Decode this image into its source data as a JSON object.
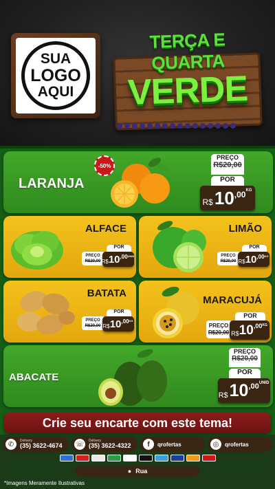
{
  "logo": {
    "line1": "SUA",
    "line2": "LOGO",
    "line3": "AQUI"
  },
  "hero": {
    "top": "TERÇA E QUARTA",
    "main": "VERDE"
  },
  "products": [
    {
      "name": "LARANJA",
      "badge": "-50%",
      "de_label": "PREÇO",
      "old_price": "R$20,00",
      "por_label": "POR",
      "currency": "R$",
      "price": "10",
      "cents": ",00",
      "unit": "KG"
    },
    {
      "name": "ALFACE",
      "de_label": "PREÇO",
      "old_price": "R$20,00",
      "por_label": "POR",
      "currency": "R$",
      "price": "10",
      "cents": ",00",
      "unit": "UNID"
    },
    {
      "name": "LIMÃO",
      "de_label": "PREÇO",
      "old_price": "R$20,00",
      "por_label": "POR",
      "currency": "R$",
      "price": "10",
      "cents": ",00",
      "unit": "KG"
    },
    {
      "name": "BATATA",
      "de_label": "PREÇO",
      "old_price": "R$20,00",
      "por_label": "POR",
      "currency": "R$",
      "price": "10",
      "cents": ",00",
      "unit": "KG"
    },
    {
      "name": "MARACUJÁ",
      "de_label": "PREÇO",
      "old_price": "R$20,00",
      "por_label": "POR",
      "currency": "R$",
      "price": "10",
      "cents": ",00",
      "unit": "KG"
    },
    {
      "name": "ABACATE",
      "de_label": "PREÇO",
      "old_price": "R$20,00",
      "por_label": "POR",
      "currency": "R$",
      "price": "10",
      "cents": ",00",
      "unit": "UNID"
    }
  ],
  "banner": "Crie seu encarte com este tema!",
  "contacts": [
    {
      "icon": "whatsapp-icon",
      "label": "Delivery",
      "value": "(35) 3622-4674"
    },
    {
      "icon": "phone-icon",
      "label": "Delivery",
      "value": "(35) 3622-4322"
    },
    {
      "icon": "facebook-icon",
      "value": "qrofertas"
    },
    {
      "icon": "instagram-icon",
      "value": "qrofertas"
    }
  ],
  "payment_colors": [
    "#2f6fd6",
    "#d42020",
    "#e9e9e9",
    "#2a9d4a",
    "#ffffff",
    "#111111",
    "#3aa0d9",
    "#1a3ea0",
    "#f39a1c",
    "#c91818"
  ],
  "address": "Rua",
  "disclaimer": "*Imagens Meramente Ilustrativas",
  "colors": {
    "green_card": "#3a9a23",
    "yellow_card": "#f0b816",
    "price_tag": "#3a2412",
    "banner": "#7a1616"
  }
}
